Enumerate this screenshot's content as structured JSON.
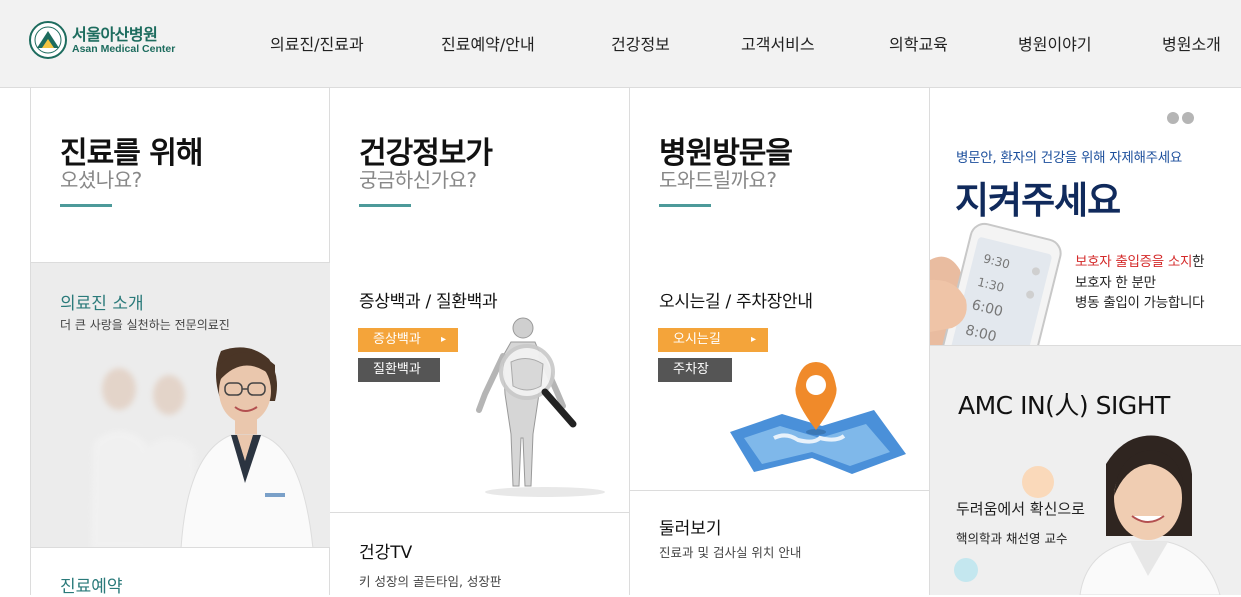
{
  "header": {
    "logo_ko": "서울아산병원",
    "logo_en": "Asan Medical Center",
    "nav": [
      "의료진/진료과",
      "진료예약/안내",
      "건강정보",
      "고객서비스",
      "의학교육",
      "병원이야기",
      "병원소개"
    ]
  },
  "col1": {
    "title": "진료를 위해",
    "subtitle": "오셨나요?",
    "doctor_title": "의료진 소개",
    "doctor_desc": "더 큰 사랑을 실천하는 전문의료진",
    "reserve_title": "진료예약"
  },
  "col2": {
    "title": "건강정보가",
    "subtitle": "궁금하신가요?",
    "section_title": "증상백과 / 질환백과",
    "btn_orange": "증상백과",
    "btn_gray": "질환백과",
    "low_title": "건강TV",
    "low_desc": "키 성장의 골든타임, 성장판"
  },
  "col3": {
    "title": "병원방문을",
    "subtitle": "도와드릴까요?",
    "section_title": "오시는길 / 주차장안내",
    "btn_orange": "오시는길",
    "btn_gray": "주차장",
    "low_title": "둘러보기",
    "low_desc": "진료과 및 검사실 위치 안내"
  },
  "col4": {
    "banner_small": "병문안, 환자의 건강을 위해 자제해주세요",
    "banner_big": "지켜주세요",
    "phone_times": [
      "9:30",
      "1:30",
      "6:00",
      "8:00"
    ],
    "note1_red": "보호자 출입증을 소지",
    "note1_end": "한",
    "note2": "보호자 한 분만",
    "note3": "병동 출입이 가능합니다",
    "insight_title": "AMC IN(人) SIGHT",
    "insight_line1": "두려움에서 확신으로",
    "insight_line2": "핵의학과 채선영 교수"
  },
  "colors": {
    "teal": "#2a7a7a",
    "orange": "#f4a43a",
    "navy": "#102a5c"
  }
}
